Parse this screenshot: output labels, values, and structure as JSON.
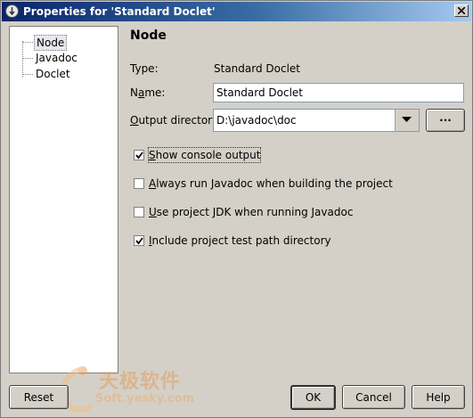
{
  "window": {
    "title": "Properties for 'Standard Doclet'",
    "close_icon": "close-icon"
  },
  "tree": {
    "items": [
      {
        "label": "Node",
        "selected": true
      },
      {
        "label": "Javadoc",
        "selected": false
      },
      {
        "label": "Doclet",
        "selected": false
      }
    ]
  },
  "panel": {
    "heading": "Node",
    "type_label": "Type:",
    "type_value": "Standard Doclet",
    "name_label_pre": "N",
    "name_label_acc": "a",
    "name_label_post": "me:",
    "name_value": "Standard Doclet",
    "outdir_label_acc": "O",
    "outdir_label_post": "utput directory:",
    "outdir_value": "D:\\javadoc\\doc",
    "browse_label": "···"
  },
  "options": [
    {
      "acc": "S",
      "rest": "how console output",
      "checked": true
    },
    {
      "acc": "A",
      "rest": "lways run Javadoc when building the project",
      "checked": false
    },
    {
      "acc": "U",
      "rest": "se project JDK when running Javadoc",
      "checked": false
    },
    {
      "acc": "I",
      "rest": "nclude project test path directory",
      "checked": true
    }
  ],
  "buttons": {
    "reset": "Reset",
    "ok": "OK",
    "cancel": "Cancel",
    "help": "Help"
  },
  "watermark": {
    "line1": "天极软件",
    "line2": "Soft.yesky.com"
  }
}
